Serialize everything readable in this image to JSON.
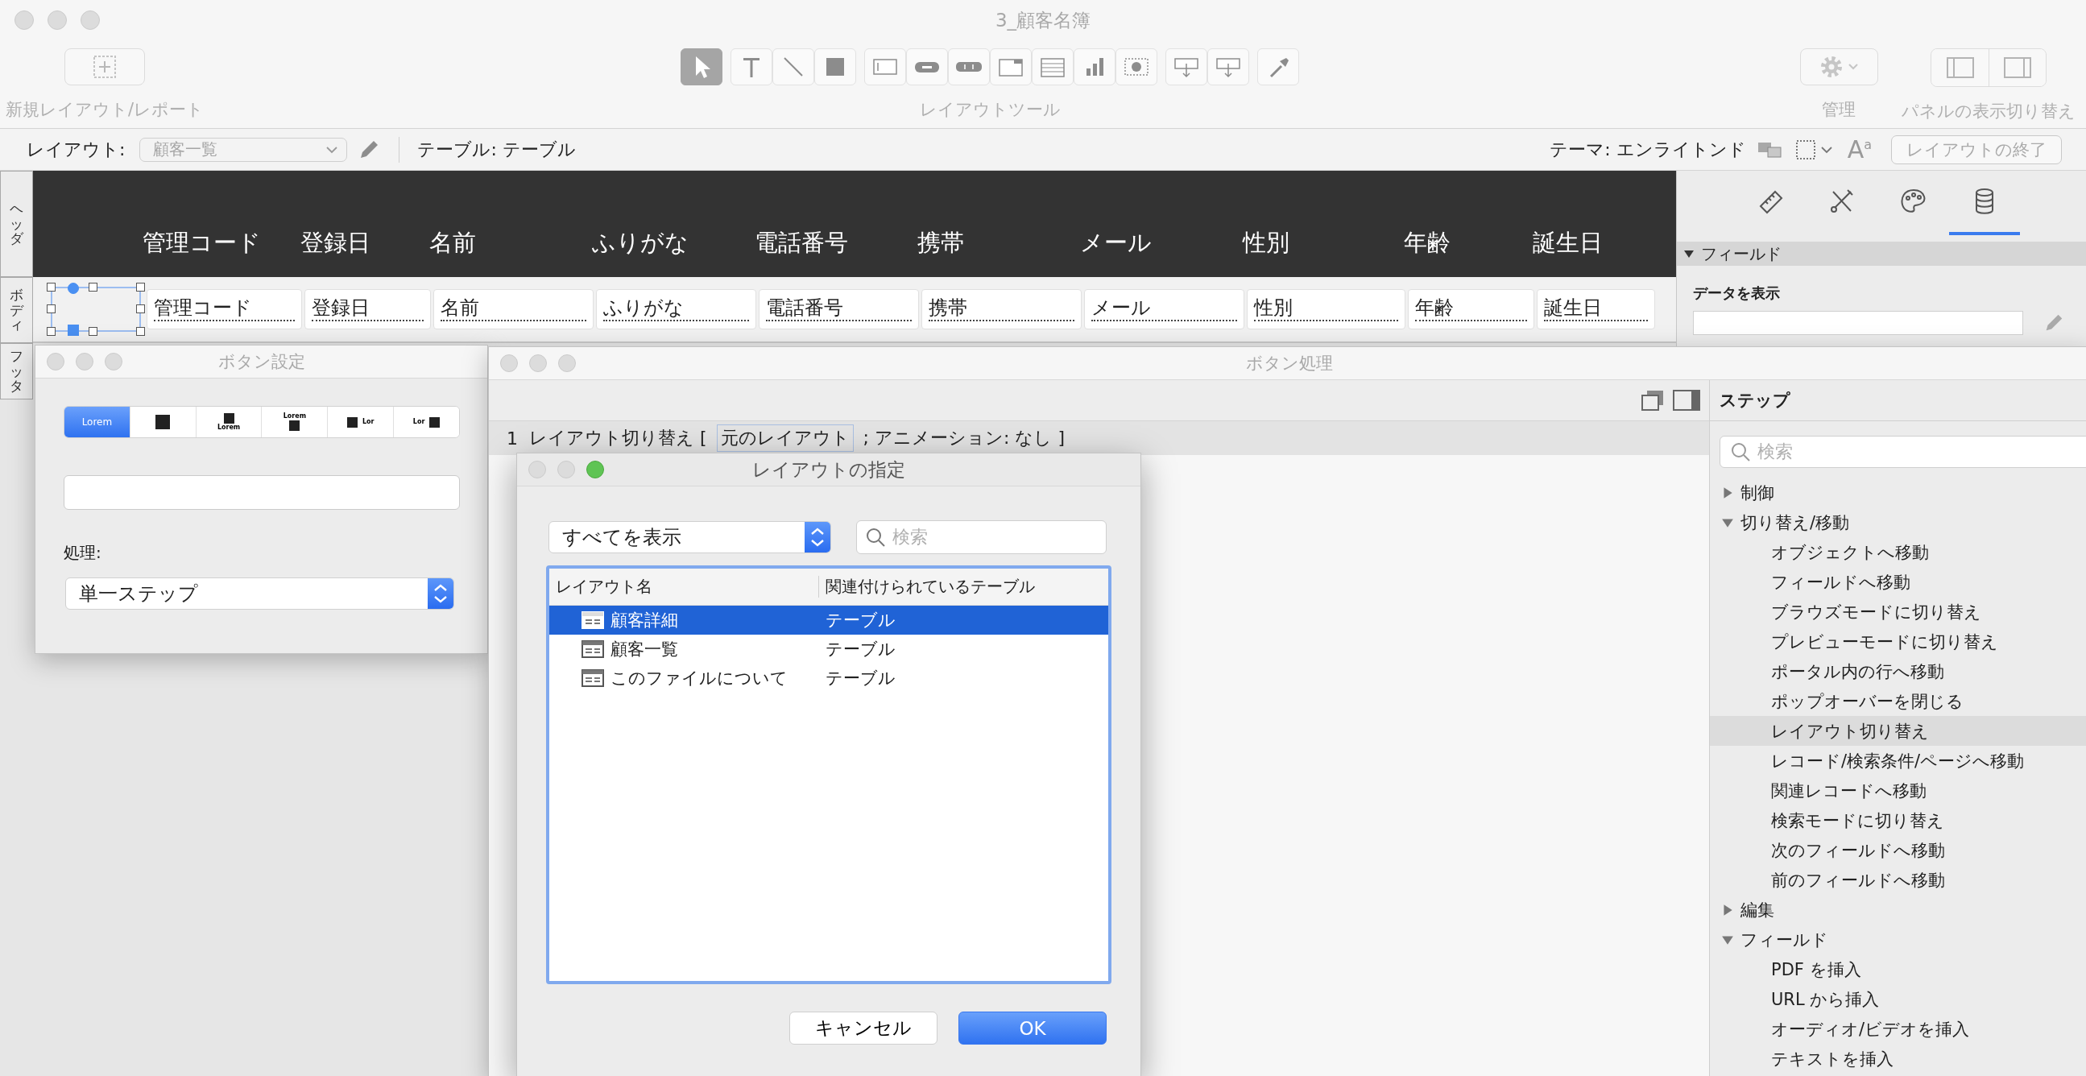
{
  "window": {
    "title": "3_顧客名簿"
  },
  "toolbar": {
    "new_layout_label": "新規レイアウト/レポート",
    "tools_label": "レイアウトツール",
    "manage_label": "管理",
    "panels_label": "パネルの表示切り替え",
    "tool_groups": [
      {
        "tools": [
          {
            "kind": "pointer",
            "selected": true
          }
        ]
      },
      {
        "tools": [
          {
            "kind": "text",
            "selected": false
          },
          {
            "kind": "line",
            "selected": false
          },
          {
            "kind": "shape",
            "selected": false
          }
        ]
      },
      {
        "tools": [
          {
            "kind": "field",
            "selected": false
          },
          {
            "kind": "button",
            "selected": false
          },
          {
            "kind": "button_bar",
            "selected": false
          },
          {
            "kind": "tab_control",
            "selected": false
          },
          {
            "kind": "portal",
            "selected": false
          },
          {
            "kind": "chart",
            "selected": false
          },
          {
            "kind": "web_viewer",
            "selected": false
          }
        ]
      },
      {
        "tools": [
          {
            "kind": "insert_part",
            "selected": false
          },
          {
            "kind": "insert_part",
            "selected": false
          }
        ]
      },
      {
        "tools": [
          {
            "kind": "eyedropper",
            "selected": false
          }
        ]
      }
    ]
  },
  "layout_bar": {
    "layout_label": "レイアウト:",
    "layout_value": "顧客一覧",
    "table_label": "テーブル: テーブル",
    "theme_label": "テーマ: エンライトンド",
    "font_button": "A$^{a}$",
    "exit_button": "レイアウトの終了"
  },
  "parts": [
    {
      "kind": "header",
      "label": "ヘッダ"
    },
    {
      "kind": "body",
      "label": "ボディ"
    },
    {
      "kind": "footer",
      "label": "フッタ"
    }
  ],
  "header_labels": [
    "管理コード",
    "登録日",
    "名前",
    "ふりがな",
    "電話番号",
    "携帯",
    "メール",
    "性別",
    "年齢",
    "誕生日"
  ],
  "body_fields": [
    "管理コード",
    "登録日",
    "名前",
    "ふりがな",
    "電話番号",
    "携帯",
    "メール",
    "性別",
    "年齢",
    "誕生日"
  ],
  "inspector": {
    "tabs": [
      {
        "kind": "position",
        "selected": false
      },
      {
        "kind": "styles",
        "selected": false
      },
      {
        "kind": "appearance",
        "selected": false
      },
      {
        "kind": "data",
        "selected": true
      }
    ],
    "section": "フィールド",
    "section_expanded": true,
    "display_data_label": "データを表示"
  },
  "button_setup": {
    "title": "ボタン設定",
    "styles": [
      {
        "kind": "label_only",
        "label": "Lorem",
        "selected": true
      },
      {
        "kind": "icon_only",
        "selected": false
      },
      {
        "kind": "icon_above",
        "label": "Lorem",
        "selected": false
      },
      {
        "kind": "label_above",
        "label": "Lorem",
        "selected": false
      },
      {
        "kind": "icon_left",
        "label": "Lor",
        "selected": false
      },
      {
        "kind": "icon_right",
        "label": "Lor",
        "selected": false
      }
    ],
    "action_label": "処理:",
    "action_value": "単一ステップ"
  },
  "script_window": {
    "title": "ボタン処理",
    "lines": [
      {
        "number": "1",
        "step": "レイアウト切り替え [",
        "parameter": "元のレイアウト",
        "rest": "; アニメーション: なし ]",
        "selected": true
      }
    ],
    "steps": {
      "title": "ステップ",
      "search_placeholder": "検索",
      "categories": [
        {
          "label": "制御",
          "expanded": false
        },
        {
          "label": "切り替え/移動",
          "expanded": true,
          "children": [
            {
              "label": "オブジェクトへ移動",
              "selected": false
            },
            {
              "label": "フィールドへ移動",
              "selected": false
            },
            {
              "label": "ブラウズモードに切り替え",
              "selected": false
            },
            {
              "label": "プレビューモードに切り替え",
              "selected": false
            },
            {
              "label": "ポータル内の行へ移動",
              "selected": false
            },
            {
              "label": "ポップオーバーを閉じる",
              "selected": false
            },
            {
              "label": "レイアウト切り替え",
              "selected": true
            },
            {
              "label": "レコード/検索条件/ページへ移動",
              "selected": false
            },
            {
              "label": "関連レコードへ移動",
              "selected": false
            },
            {
              "label": "検索モードに切り替え",
              "selected": false
            },
            {
              "label": "次のフィールドへ移動",
              "selected": false
            },
            {
              "label": "前のフィールドへ移動",
              "selected": false
            }
          ]
        },
        {
          "label": "編集",
          "expanded": false
        },
        {
          "label": "フィールド",
          "expanded": true,
          "children": [
            {
              "label": "PDF を挿入",
              "selected": false
            },
            {
              "label": "URL から挿入",
              "selected": false
            },
            {
              "label": "オーディオ/ビデオを挿入",
              "selected": false
            },
            {
              "label": "テキストを挿入",
              "selected": false
            }
          ]
        }
      ]
    }
  },
  "layout_dialog": {
    "title": "レイアウトの指定",
    "filter": "すべてを表示",
    "search_placeholder": "検索",
    "columns": [
      "レイアウト名",
      "関連付けられているテーブル"
    ],
    "rows": [
      {
        "name": "顧客詳細",
        "table": "テーブル",
        "selected": true
      },
      {
        "name": "顧客一覧",
        "table": "テーブル",
        "selected": false
      },
      {
        "name": "このファイルについて",
        "table": "テーブル",
        "selected": false
      }
    ],
    "buttons": [
      {
        "kind": "cancel",
        "label": "キャンセル"
      },
      {
        "kind": "default",
        "label": "OK"
      }
    ]
  }
}
